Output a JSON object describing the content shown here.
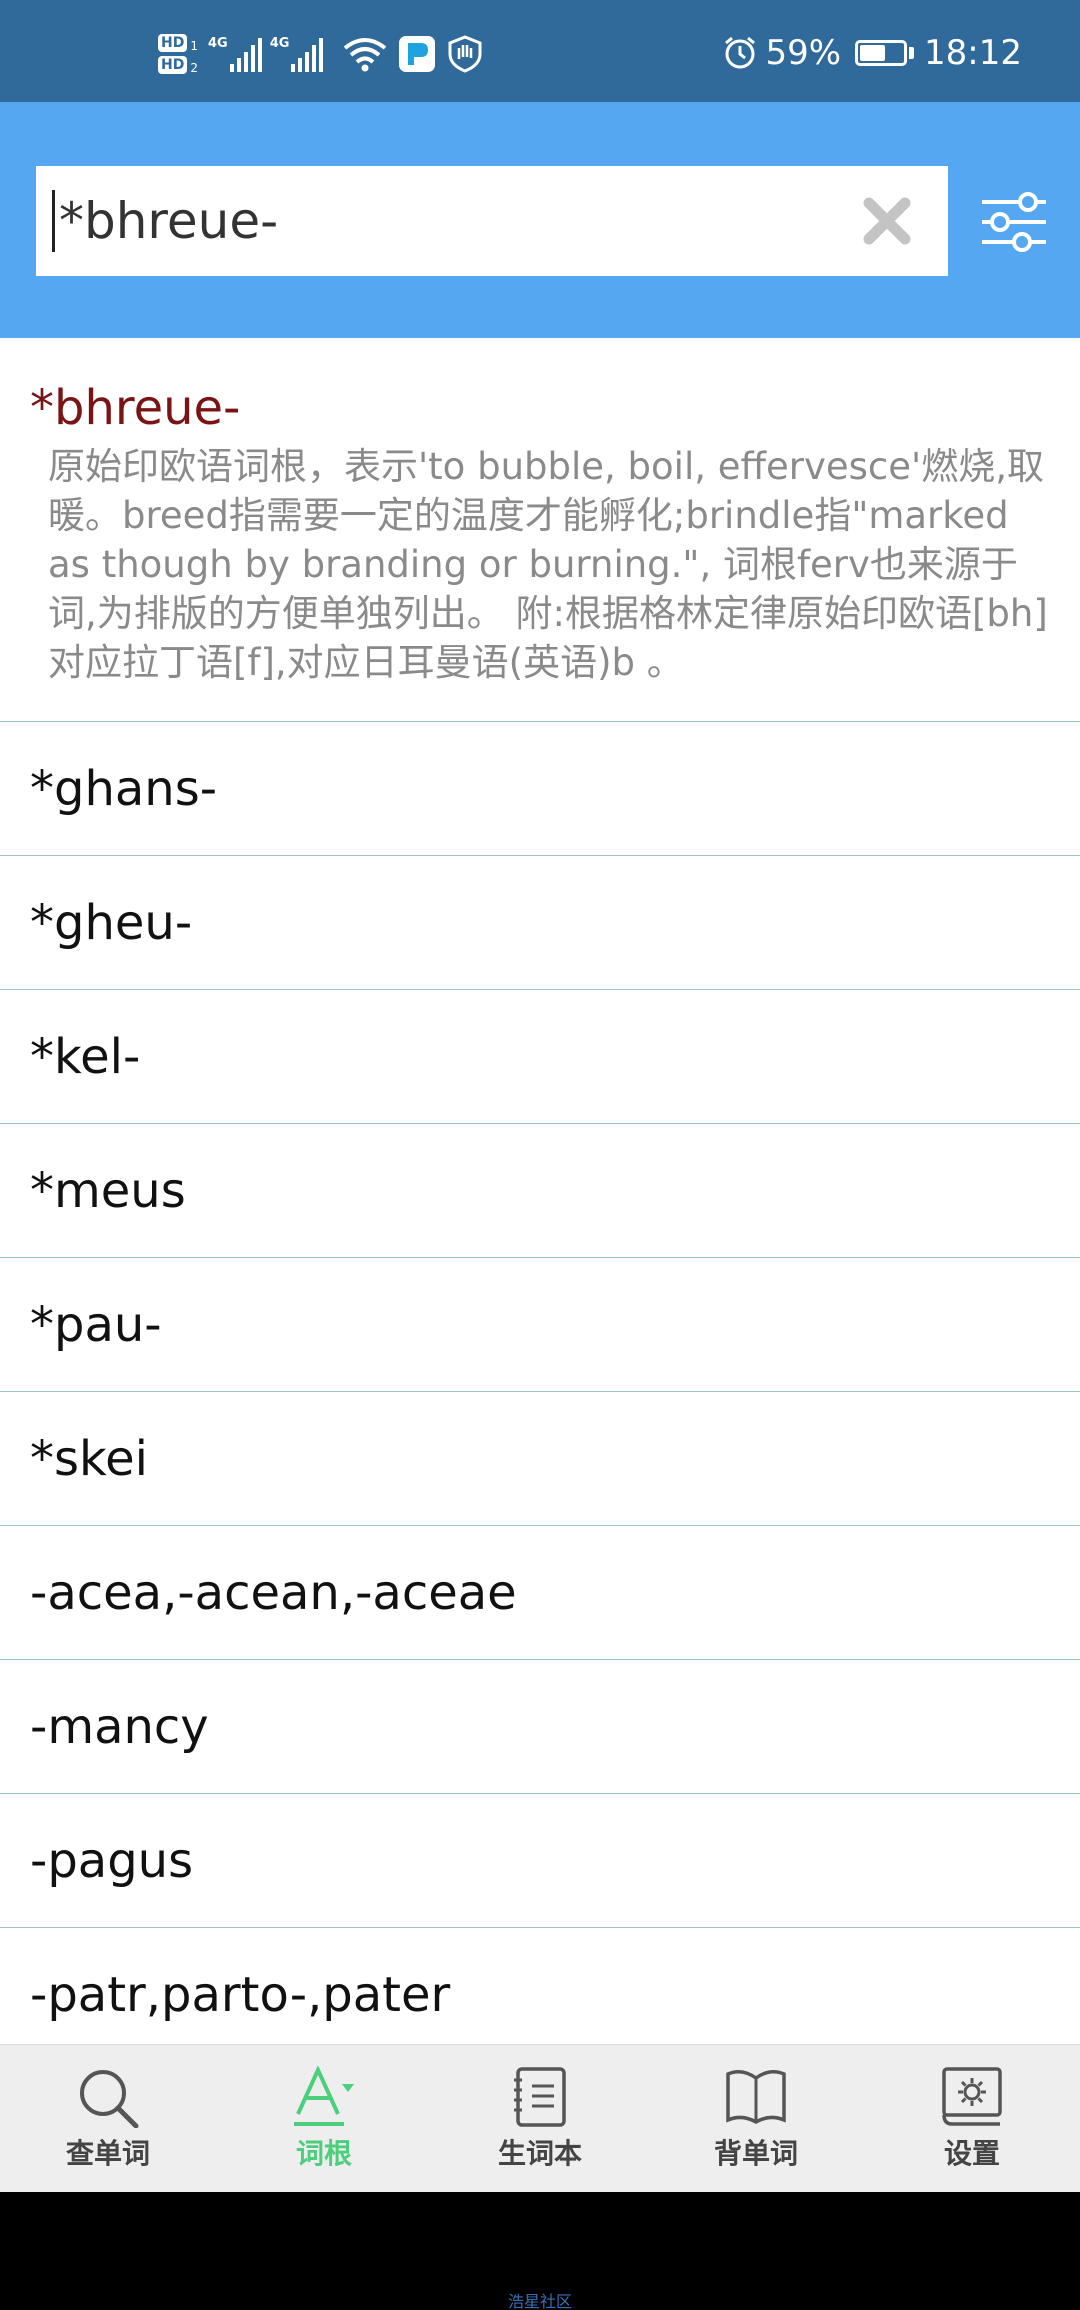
{
  "status_bar": {
    "hd1": "HD",
    "hd1_sub": "1",
    "hd2": "HD",
    "hd2_sub": "2",
    "net1": "4G",
    "net2": "4G",
    "battery_percent": "59%",
    "battery_level": 0.59,
    "time": "18:12"
  },
  "search": {
    "value": "*bhreue-"
  },
  "featured": {
    "term": "*bhreue-",
    "definition": "原始印欧语词根，表示'to bubble, boil, effervesce'燃烧,取暖。breed指需要一定的温度才能孵化;brindle指\"marked as though by branding or burning.\", 词根ferv也来源于词,为排版的方便单独列出。 附:根据格林定律原始印欧语[bh]对应拉丁语[f],对应日耳曼语(英语)b 。"
  },
  "list_items": [
    "*ghans-",
    "*gheu-",
    "*kel-",
    "*meus",
    "*pau-",
    "*skei",
    "-acea,-acean,-aceae",
    "-mancy",
    "-pagus",
    "-patr,parto-,pater"
  ],
  "nav": {
    "items": [
      {
        "label": "查单词",
        "icon": "search-icon"
      },
      {
        "label": "词根",
        "icon": "font-a-icon"
      },
      {
        "label": "生词本",
        "icon": "notebook-icon"
      },
      {
        "label": "背单词",
        "icon": "open-book-icon"
      },
      {
        "label": "设置",
        "icon": "settings-book-icon"
      }
    ],
    "active_index": 1
  },
  "watermark": "浩星社区",
  "colors": {
    "status_bar": "#2f6a9b",
    "header": "#55a7f1",
    "featured_term": "#7a1414",
    "active_tab": "#4ccf7d",
    "divider": "#9ec6c9"
  }
}
